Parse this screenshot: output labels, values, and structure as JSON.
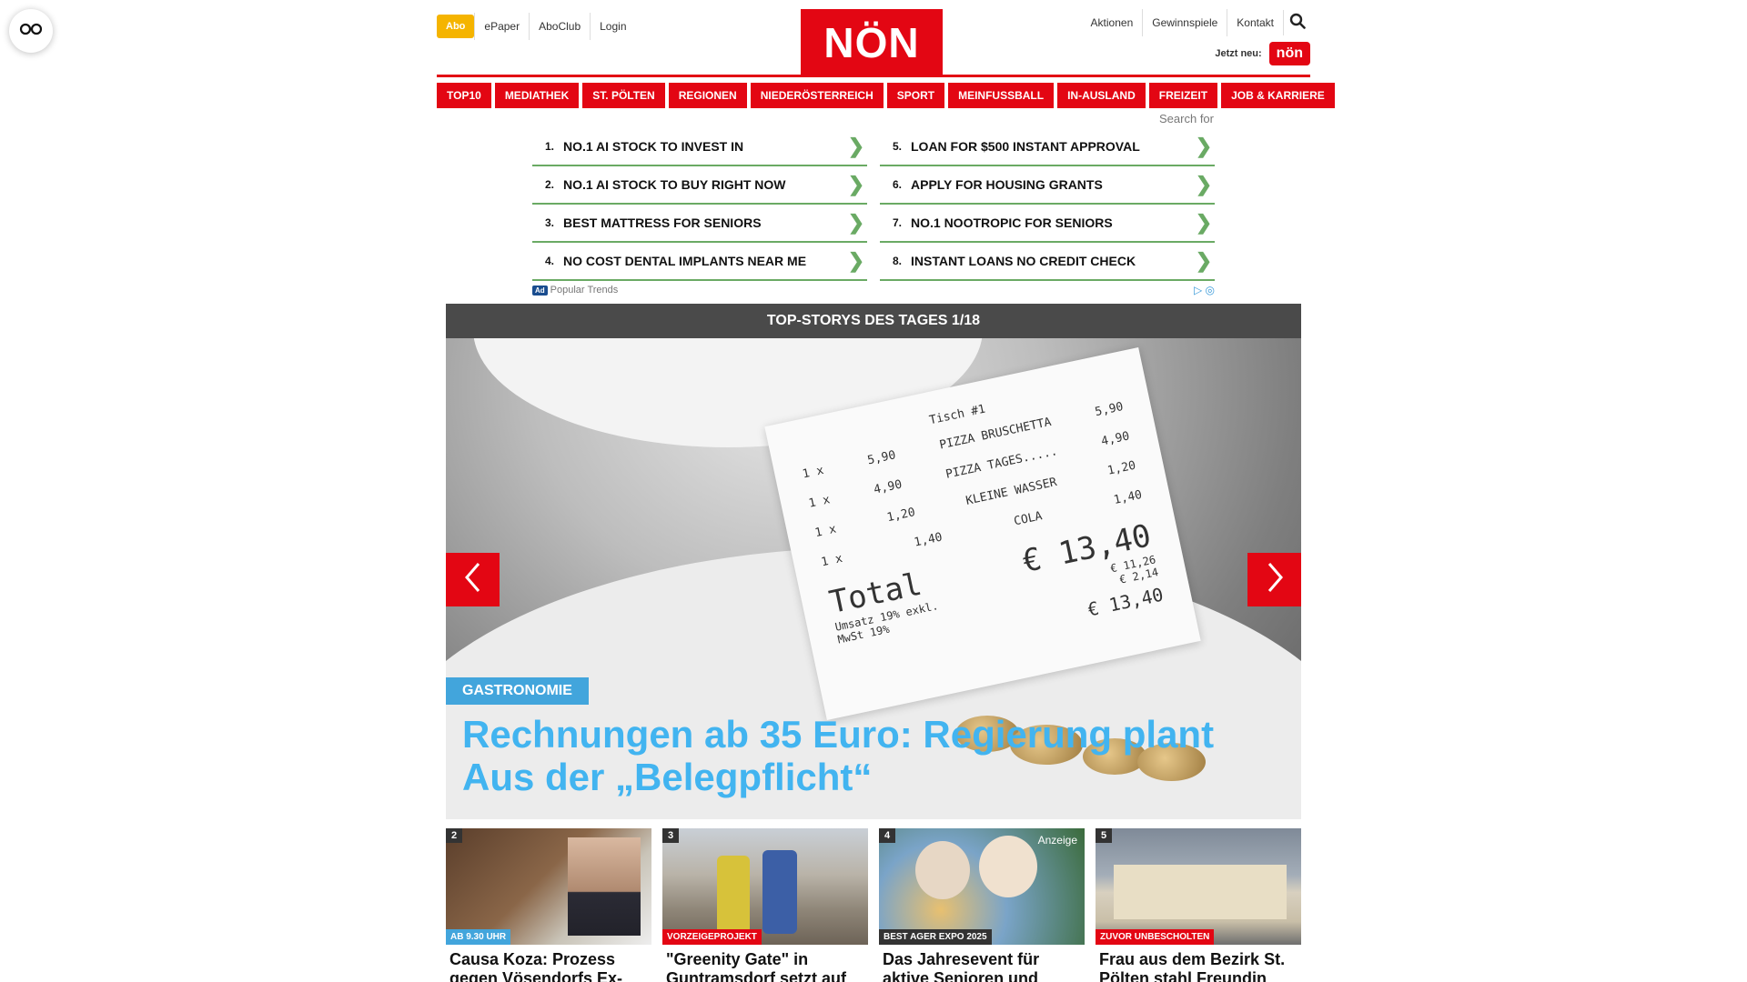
{
  "floating_button": {
    "icon": "glasses-icon"
  },
  "header": {
    "abo_label": "Abo",
    "left_links": [
      "ePaper",
      "AboClub",
      "Login"
    ],
    "logo_text": "NÖN",
    "right_links": [
      "Aktionen",
      "Gewinnspiele",
      "Kontakt"
    ],
    "jetzt_label": "Jetzt neu:",
    "jetzt_logo_text": "nön",
    "brand_color": "#e30613"
  },
  "nav": [
    "TOP10",
    "MEDIATHEK",
    "ST. PÖLTEN",
    "REGIONEN",
    "NIEDERÖSTERREICH",
    "SPORT",
    "MEINFUSSBALL",
    "IN-AUSLAND",
    "FREIZEIT",
    "JOB & KARRIERE"
  ],
  "search_ads": {
    "search_label": "Search for",
    "left": [
      {
        "num": "1.",
        "text": "NO.1 AI STOCK TO INVEST IN"
      },
      {
        "num": "2.",
        "text": "NO.1 AI STOCK TO BUY RIGHT NOW"
      },
      {
        "num": "3.",
        "text": "BEST MATTRESS FOR SENIORS"
      },
      {
        "num": "4.",
        "text": "NO COST DENTAL IMPLANTS NEAR ME"
      }
    ],
    "right": [
      {
        "num": "5.",
        "text": "LOAN FOR $500 INSTANT APPROVAL"
      },
      {
        "num": "6.",
        "text": "APPLY FOR HOUSING GRANTS"
      },
      {
        "num": "7.",
        "text": "NO.1 NOOTROPIC FOR SENIORS"
      },
      {
        "num": "8.",
        "text": "INSTANT LOANS NO CREDIT CHECK"
      }
    ],
    "ad_badge": "Ad",
    "footer_text": "Popular Trends"
  },
  "top_stories": {
    "bar_title": "TOP-STORYS DES TAGES 1/18",
    "hero": {
      "tag": "GASTRONOMIE",
      "title": "Rechnungen ab 35 Euro: Regierung plant Aus der „Belegpflicht“",
      "receipt": {
        "header": "Tisch #1",
        "lines": [
          {
            "qty": "1 x",
            "price": "5,90",
            "item": "PIZZA BRUSCHETTA",
            "sum": "5,90"
          },
          {
            "qty": "1 x",
            "price": "4,90",
            "item": "PIZZA TAGES.....",
            "sum": "4,90"
          },
          {
            "qty": "1 x",
            "price": "1,20",
            "item": "KLEINE WASSER",
            "sum": "1,20"
          },
          {
            "qty": "1 x",
            "price": "1,40",
            "item": "COLA",
            "sum": "1,40"
          }
        ],
        "total_label": "Total",
        "total": "€ 13,40",
        "net": "€ 11,26",
        "vat": "€ 2,14",
        "vat_note": "Umsatz 19% exkl.",
        "mwst": "MwSt 19%",
        "paid": "€ 13,40"
      }
    }
  },
  "cards": [
    {
      "num": "2",
      "tag": "AB 9.30 UHR",
      "tag_color": "#42a5dc",
      "title": "Causa Koza: Prozess gegen Vösendorfs Ex-",
      "anzeige": ""
    },
    {
      "num": "3",
      "tag": "VORZEIGEPROJEKT",
      "tag_color": "#e30613",
      "title": "\"Greenity Gate\" in Guntramsdorf setzt auf",
      "anzeige": ""
    },
    {
      "num": "4",
      "tag": "BEST AGER EXPO 2025",
      "tag_color": "#333333",
      "title": "Das Jahresevent für aktive Senioren und",
      "anzeige": "Anzeige"
    },
    {
      "num": "5",
      "tag": "ZUVOR UNBESCHOLTEN",
      "tag_color": "#e30613",
      "title": "Frau aus dem Bezirk St. Pölten stahl Freundin",
      "anzeige": ""
    }
  ]
}
